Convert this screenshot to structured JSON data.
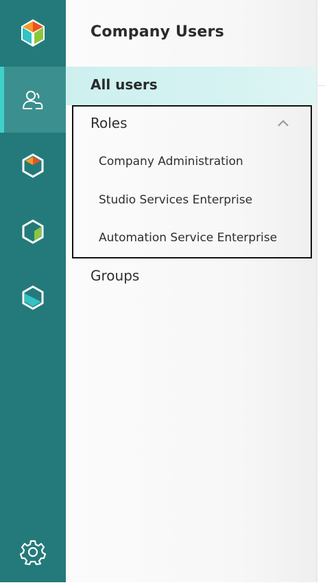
{
  "sidebar": {
    "logo_icon": "brand-cube-icon",
    "items": [
      {
        "icon": "users-icon",
        "active": true
      },
      {
        "icon": "cube-orange-icon",
        "active": false
      },
      {
        "icon": "cube-green-icon",
        "active": false
      },
      {
        "icon": "cube-teal-icon",
        "active": false
      }
    ],
    "settings_icon": "gear-icon"
  },
  "panel": {
    "title": "Company Users",
    "all_users_label": "All users",
    "roles": {
      "label": "Roles",
      "expanded": true,
      "items": [
        "Company Administration",
        "Studio Services Enterprise",
        "Automation Service Enterprise"
      ]
    },
    "groups_label": "Groups"
  },
  "colors": {
    "rail": "#247a7a",
    "rail_active": "#3c8f8f",
    "accent": "#3fd1c8",
    "selection": "#cdf0ef"
  }
}
